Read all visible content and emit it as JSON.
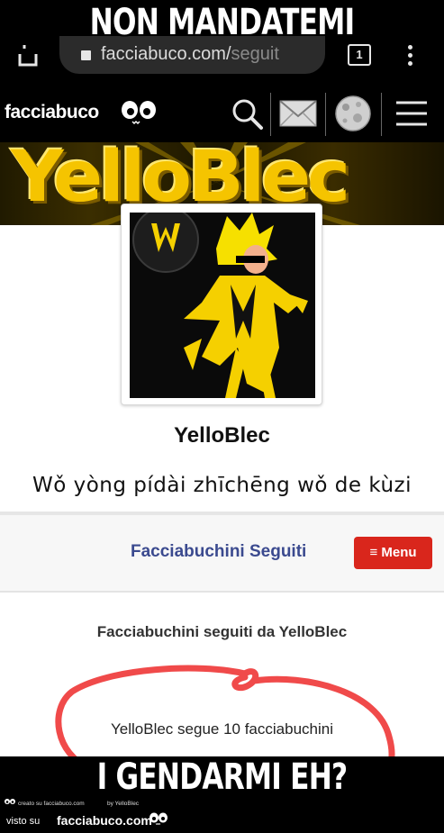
{
  "meme": {
    "top_caption": "NON MANDATEMI",
    "bottom_caption": "I GENDARMI EH?"
  },
  "browser": {
    "url_main": "facciabuco.com/",
    "url_faded": "seguit",
    "tabs_count": "1"
  },
  "site_header": {
    "logo": "facciabuco"
  },
  "banner": {
    "title": "YelloBlec"
  },
  "profile": {
    "name": "YelloBlec",
    "bio": "Wǒ yòng pídài zhīchēng wǒ de kùzi"
  },
  "nav": {
    "title": "Facciabuchini Seguiti",
    "menu_label": "≡ Menu"
  },
  "following": {
    "heading": "Facciabuchini seguiti da YelloBlec",
    "count_text": "YelloBlec segue 10 facciabuchini"
  },
  "watermark": {
    "created": "creato su facciabuco.com",
    "by": "by YelloBlec",
    "visto": "visto su",
    "site": "facciabuco.com"
  },
  "colors": {
    "menu_button": "#d9261c",
    "nav_title": "#3b4a8f",
    "banner_yellow": "#f5c400",
    "scribble_red": "#f04a4a"
  }
}
